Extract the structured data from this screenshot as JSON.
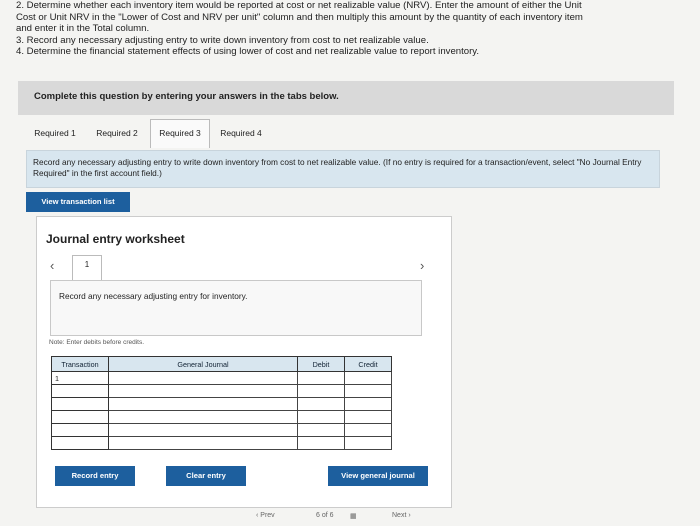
{
  "instructions": {
    "line1": "2. Determine whether each inventory item would be reported at cost or net realizable value (NRV). Enter the amount of either the Unit",
    "line2": "Cost or Unit NRV in the \"Lower of Cost and NRV per unit\" column and then multiply this amount by the quantity of each inventory item",
    "line3": "and enter it in the Total column.",
    "line4": "3. Record any necessary adjusting entry to write down inventory from cost to net realizable value.",
    "line5": "4. Determine the financial statement effects of using lower of cost and net realizable value to report inventory."
  },
  "banner": "Complete this question by entering your answers in the tabs below.",
  "tabs": [
    "Required 1",
    "Required 2",
    "Required 3",
    "Required 4"
  ],
  "active_tab": "Required 3",
  "prompt": "Record any necessary adjusting entry to write down inventory from cost to net realizable value. (If no entry is required for a transaction/event, select \"No Journal Entry Required\" in the first account field.)",
  "view_transaction_list": "View transaction list",
  "worksheet": {
    "title": "Journal entry worksheet",
    "page_number": "1",
    "prev_icon": "chevron-left-icon",
    "next_icon": "chevron-right-icon",
    "record_text": "Record any necessary adjusting entry for inventory.",
    "note": "Note: Enter debits before credits.",
    "columns": [
      "Transaction",
      "General Journal",
      "Debit",
      "Credit"
    ],
    "first_transaction": "1"
  },
  "buttons": {
    "record": "Record entry",
    "clear": "Clear entry",
    "view_general_journal": "View general journal"
  },
  "footer": {
    "prev": "Prev",
    "page": "6 of 6",
    "next": "Next"
  },
  "colors": {
    "accent": "#1d5f9e",
    "prompt_bg": "#d8e6ef",
    "banner_bg": "#d9d9d9"
  }
}
